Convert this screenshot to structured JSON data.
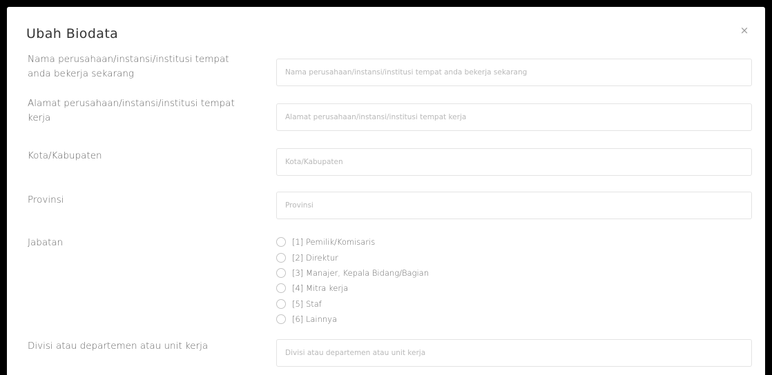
{
  "modal": {
    "title": "Ubah Biodata",
    "close_label": "×"
  },
  "fields": {
    "company_name": {
      "label": "Nama perusahaan/instansi/institusi tempat anda bekerja sekarang",
      "placeholder": "Nama perusahaan/instansi/institusi tempat anda bekerja sekarang",
      "value": ""
    },
    "company_address": {
      "label": "Alamat perusahaan/instansi/institusi tempat kerja",
      "placeholder": "Alamat perusahaan/instansi/institusi tempat kerja",
      "value": ""
    },
    "city": {
      "label": "Kota/Kabupaten",
      "placeholder": "Kota/Kabupaten",
      "value": ""
    },
    "province": {
      "label": "Provinsi",
      "placeholder": "Provinsi",
      "value": ""
    },
    "position": {
      "label": "Jabatan",
      "options": [
        "[1] Pemilik/Komisaris",
        "[2] Direktur",
        "[3] Manajer, Kepala Bidang/Bagian",
        "[4] Mitra kerja",
        "[5] Staf",
        "[6] Lainnya"
      ],
      "selected": null
    },
    "division": {
      "label": "Divisi atau departemen atau unit kerja",
      "placeholder": "Divisi atau departemen atau unit kerja",
      "value": ""
    }
  }
}
